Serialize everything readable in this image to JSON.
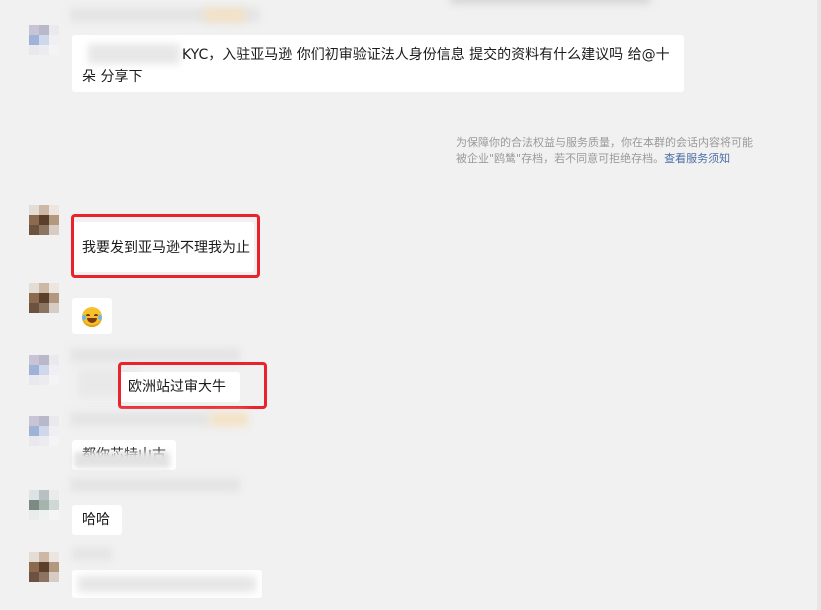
{
  "messages": [
    {
      "id": "m1",
      "text": "KYC，入驻亚马逊 你们初审验证法人身份信息 提交的资料有什么建议吗 给@十朵 分享下"
    },
    {
      "id": "m2",
      "text": "我要发到亚马逊不理我为止"
    },
    {
      "id": "m3",
      "text": "😂",
      "emoji": "laughing-tears"
    },
    {
      "id": "m4",
      "text": "欧洲站过审大牛"
    },
    {
      "id": "m5",
      "text": "都你芯特山古"
    },
    {
      "id": "m6",
      "text": "哈哈"
    }
  ],
  "notice": {
    "text": "为保障你的合法权益与服务质量，你在本群的会话内容将可能被企业\"鸥鸶\"存档，若不同意可拒绝存档。",
    "link": "查看服务须知"
  },
  "colors": {
    "highlight": "#e8232b",
    "link": "#4a6fa5",
    "bg": "#f1f1f1"
  }
}
